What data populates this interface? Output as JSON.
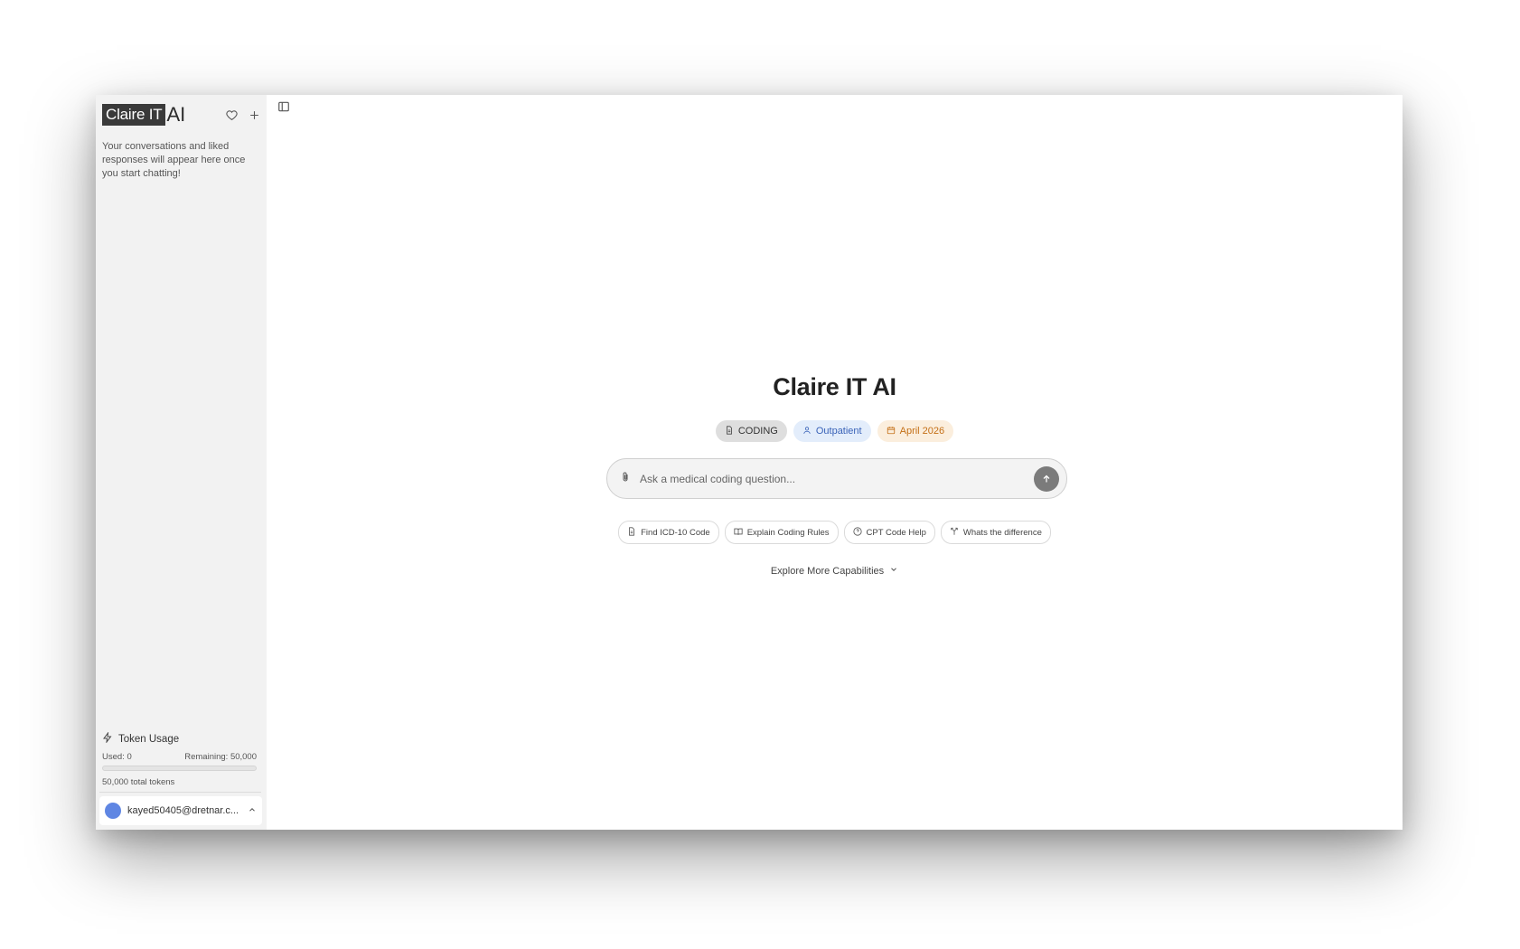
{
  "sidebar": {
    "logo_text_boxed": "Claire IT",
    "logo_text_suffix": "AI",
    "empty_message": "Your conversations and liked responses will appear here once you start chatting!",
    "token_usage": {
      "title": "Token Usage",
      "used_label": "Used: 0",
      "remaining_label": "Remaining: 50,000",
      "total_label": "50,000 total tokens",
      "used_fraction": 0
    },
    "user": {
      "email": "kayed50405@dretnar.c..."
    }
  },
  "main": {
    "title": "Claire IT AI",
    "tags": [
      {
        "label": "CODING",
        "icon": "document-icon"
      },
      {
        "label": "Outpatient",
        "icon": "user-icon"
      },
      {
        "label": "April 2026",
        "icon": "calendar-icon"
      }
    ],
    "search": {
      "placeholder": "Ask a medical coding question..."
    },
    "suggestions": [
      {
        "label": "Find ICD-10 Code",
        "icon": "document-icon"
      },
      {
        "label": "Explain Coding Rules",
        "icon": "book-icon"
      },
      {
        "label": "CPT Code Help",
        "icon": "help-circle-icon"
      },
      {
        "label": "Whats the difference",
        "icon": "split-icon"
      }
    ],
    "explore_label": "Explore More Capabilities"
  },
  "colors": {
    "avatar": "#5f86e3",
    "outpatient_tag_bg": "#e3edfb",
    "outpatient_tag_text": "#3a63b8",
    "date_tag_bg": "#fbeedd",
    "date_tag_text": "#c46f16"
  }
}
